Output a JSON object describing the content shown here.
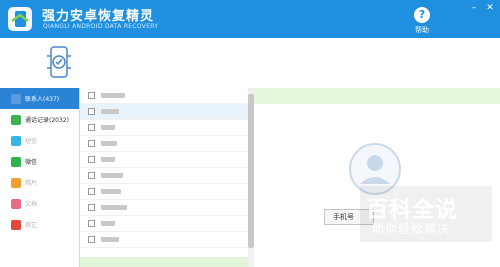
{
  "app": {
    "title": "强力安卓恢复精灵",
    "subtitle": "QIANGLI ANDROID DATA RECOVERY",
    "help_label": "帮助",
    "window_controls": [
      "minimize-icon",
      "close-icon"
    ]
  },
  "colors": {
    "titlebar": "#1f8fe0",
    "active_sidebar": "#2a83d6",
    "list_selected": "#e9f3fb",
    "green_strip": "#e6f7dc"
  },
  "sidebar": {
    "items": [
      {
        "label": "联系人(437)",
        "icon": "contacts-icon",
        "color": "#5a9be0",
        "active": true,
        "dim": false
      },
      {
        "label": "通话记录(2032)",
        "icon": "phone-icon",
        "color": "#3cb44a",
        "active": false,
        "dim": false
      },
      {
        "label": "短信",
        "icon": "sms-icon",
        "color": "#36b5e6",
        "active": false,
        "dim": true
      },
      {
        "label": "微信",
        "icon": "wechat-icon",
        "color": "#2db34a",
        "active": false,
        "dim": false
      },
      {
        "label": "照片",
        "icon": "photo-icon",
        "color": "#f0a030",
        "active": false,
        "dim": true
      },
      {
        "label": "文档",
        "icon": "document-icon",
        "color": "#e86a8a",
        "active": false,
        "dim": true
      },
      {
        "label": "其它",
        "icon": "apps-icon",
        "color": "#e04a3a",
        "active": false,
        "dim": true
      }
    ]
  },
  "contact_list": {
    "rows": [
      {
        "name": "",
        "selected": false
      },
      {
        "name": "",
        "selected": true
      },
      {
        "name": "",
        "selected": false
      },
      {
        "name": "",
        "selected": false
      },
      {
        "name": "",
        "selected": false
      },
      {
        "name": "",
        "selected": false
      },
      {
        "name": "",
        "selected": false
      },
      {
        "name": "",
        "selected": false
      },
      {
        "name": "",
        "selected": false
      },
      {
        "name": "",
        "selected": false
      }
    ]
  },
  "detail": {
    "phone_button_label": "手机号"
  },
  "watermark": {
    "title": "百科全说",
    "subtitle": "助你轻松解决"
  }
}
